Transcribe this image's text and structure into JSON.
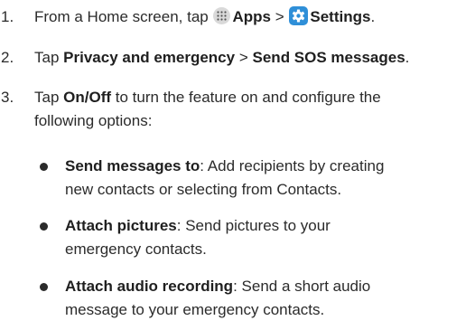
{
  "steps": [
    {
      "number": "1.",
      "text_1": "From a Home screen, tap",
      "apps_icon": "apps-grid-icon",
      "apps_label": "Apps",
      "separator": ">",
      "settings_icon": "settings-gear-icon",
      "settings_label": "Settings",
      "end": "."
    },
    {
      "number": "2.",
      "text_1": "Tap",
      "privacy_label": "Privacy and emergency",
      "separator": ">",
      "sos_label": "Send SOS messages",
      "end": "."
    },
    {
      "number": "3.",
      "text_1": "Tap",
      "onoff_label": "On/Off",
      "line1_rest": "to turn the feature on and configure the",
      "line2": "following options:"
    }
  ],
  "options": [
    {
      "title": "Send messages to",
      "desc_line1": ": Add recipients by creating",
      "desc_line2": "new contacts or selecting from Contacts."
    },
    {
      "title": "Attach pictures",
      "desc_line1": ": Send pictures to your",
      "desc_line2": "emergency contacts."
    },
    {
      "title": "Attach audio recording",
      "desc_line1": ": Send a short audio",
      "desc_line2": "message to your emergency contacts."
    }
  ],
  "colors": {
    "settings_icon_bg": "#2f8fd8",
    "apps_icon_bg": "#d9d9d9",
    "text": "#2b2b2b"
  }
}
